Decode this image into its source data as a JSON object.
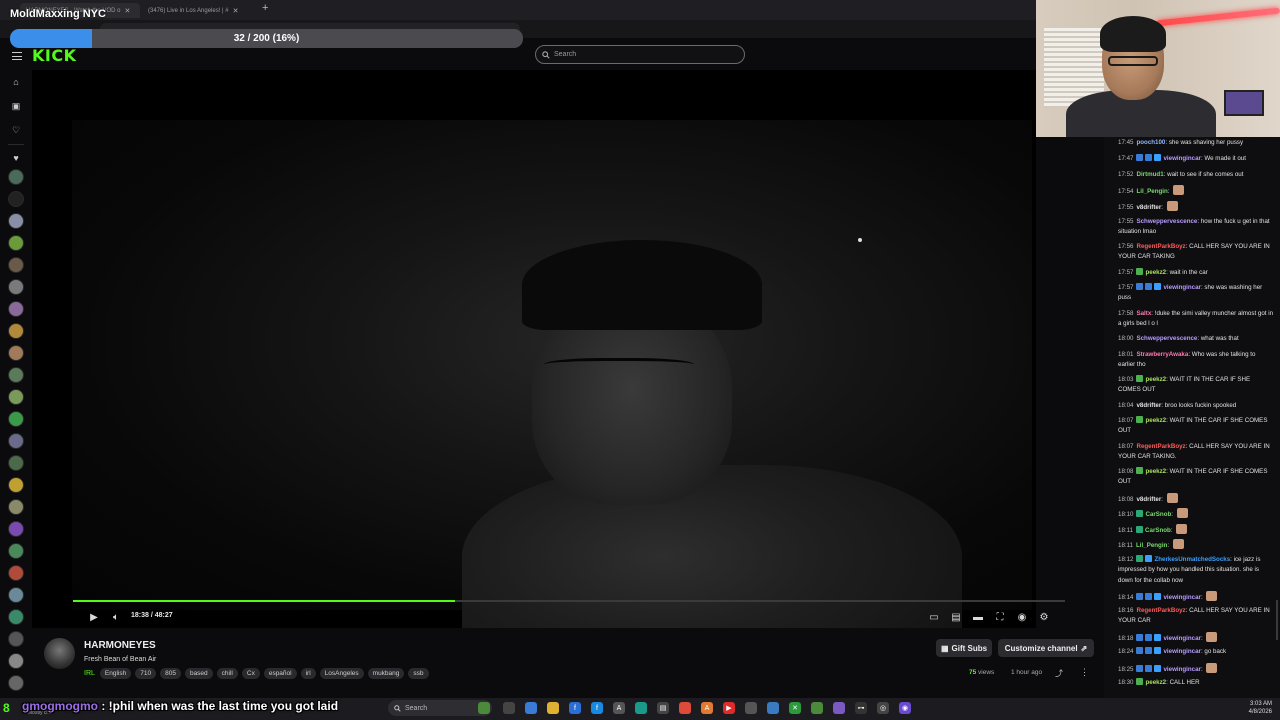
{
  "stream_overlay": {
    "title": "MoldMaxxing NYC",
    "progress_label": "32 / 200 (16%)",
    "progress_fraction": 0.16
  },
  "browser": {
    "tabs": [
      {
        "label": "HARMONEYES - Watch the VOD o"
      },
      {
        "label": "(3476) Live in Los Angeles! | #"
      }
    ]
  },
  "header": {
    "logo": "KICK",
    "search_placeholder": "Search"
  },
  "player": {
    "time": "18:38 / 48:27",
    "seek_fraction": 0.385
  },
  "channel": {
    "name": "HARMONEYES",
    "stream_title": "Fresh Bean of Bean Air",
    "category": "IRL",
    "tags": [
      "English",
      "710",
      "805",
      "based",
      "chill",
      "Cx",
      "español",
      "irl",
      "LosAngeles",
      "mukbang",
      "ssb"
    ],
    "gift_label": "Gift Subs",
    "customize_label": "Customize channel",
    "views_count": "75",
    "views_label": "views",
    "uptime": "1 hour ago"
  },
  "chat": {
    "messages": [
      {
        "ts": "17:45",
        "user": "pooch100",
        "color": "#8fb8ff",
        "text": "she was shaving her pussy",
        "badges": [],
        "emote": false
      },
      {
        "ts": "17:47",
        "user": "viewingincar",
        "color": "#b79cff",
        "text": "We made it out",
        "badges": [
          "#3a7bd5",
          "#3a7bd5",
          "#3aa0ff"
        ],
        "emote": false
      },
      {
        "ts": "17:52",
        "user": "Dirtmud1",
        "color": "#7ad96f",
        "text": "wait to see if she comes out",
        "badges": [],
        "emote": false
      },
      {
        "ts": "17:54",
        "user": "Lil_Pengin",
        "color": "#7ad96f",
        "text": "",
        "badges": [],
        "emote": true
      },
      {
        "ts": "17:55",
        "user": "v8drifter",
        "color": "#e2e2e2",
        "text": "",
        "badges": [],
        "emote": true
      },
      {
        "ts": "17:55",
        "user": "Schweppervescence",
        "color": "#b79cff",
        "text": "how the fuck u get in that situation lmao",
        "badges": [],
        "emote": false
      },
      {
        "ts": "17:56",
        "user": "RegentParkBoyz",
        "color": "#ff5a5a",
        "text": "CALL HER SAY YOU ARE IN YOUR CAR TAKING",
        "badges": [],
        "emote": false
      },
      {
        "ts": "17:57",
        "user": "peekz2",
        "color": "#a8e05f",
        "text": "wait in the car",
        "badges": [
          "#4caf50"
        ],
        "emote": false
      },
      {
        "ts": "17:57",
        "user": "viewingincar",
        "color": "#b79cff",
        "text": "she was washing her puss",
        "badges": [
          "#3a7bd5",
          "#3a7bd5",
          "#3aa0ff"
        ],
        "emote": false
      },
      {
        "ts": "17:58",
        "user": "Saltx",
        "color": "#ff7ab0",
        "text": "!duke the simi valley muncher almost got in a girls bed l o l",
        "badges": [],
        "emote": false
      },
      {
        "ts": "18:00",
        "user": "Schweppervescence",
        "color": "#b79cff",
        "text": "what was that",
        "badges": [],
        "emote": false
      },
      {
        "ts": "18:01",
        "user": "StrawberryAwaka",
        "color": "#ff7ab0",
        "text": "Who was she talking to earlier tho",
        "badges": [],
        "emote": false
      },
      {
        "ts": "18:03",
        "user": "peekz2",
        "color": "#a8e05f",
        "text": "WAIT IT IN THE CAR IF SHE COMES OUT",
        "badges": [
          "#4caf50"
        ],
        "emote": false
      },
      {
        "ts": "18:04",
        "user": "v8drifter",
        "color": "#e2e2e2",
        "text": "broo looks fuckin spooked",
        "badges": [],
        "emote": false
      },
      {
        "ts": "18:07",
        "user": "peekz2",
        "color": "#a8e05f",
        "text": "WAIT IN THE CAR IF SHE COMES OUT",
        "badges": [
          "#4caf50"
        ],
        "emote": false
      },
      {
        "ts": "18:07",
        "user": "RegentParkBoyz",
        "color": "#ff5a5a",
        "text": "CALL HER SAY YOU ARE IN YOUR CAR TAKING.",
        "badges": [],
        "emote": false
      },
      {
        "ts": "18:08",
        "user": "peekz2",
        "color": "#a8e05f",
        "text": "WAIT IN THE CAR IF SHE COMES OUT",
        "badges": [
          "#4caf50"
        ],
        "emote": false
      },
      {
        "ts": "18:08",
        "user": "v8drifter",
        "color": "#e2e2e2",
        "text": "",
        "badges": [],
        "emote": true
      },
      {
        "ts": "18:10",
        "user": "CarSnob",
        "color": "#7ad96f",
        "text": "",
        "badges": [
          "#2aa876"
        ],
        "emote": true
      },
      {
        "ts": "18:11",
        "user": "CarSnob",
        "color": "#7ad96f",
        "text": "",
        "badges": [
          "#2aa876"
        ],
        "emote": true
      },
      {
        "ts": "18:11",
        "user": "Lil_Pengin",
        "color": "#7ad96f",
        "text": "",
        "badges": [],
        "emote": true
      },
      {
        "ts": "18:12",
        "user": "ZherkesUnmatchedSocks",
        "color": "#3aa0ff",
        "text": "ice jazz is impressed by how you handled this situation. she is down for the collab now",
        "badges": [
          "#2aa876",
          "#3aa0ff"
        ],
        "emote": false
      },
      {
        "ts": "18:14",
        "user": "viewingincar",
        "color": "#b79cff",
        "text": "",
        "badges": [
          "#3a7bd5",
          "#3a7bd5",
          "#3aa0ff"
        ],
        "emote": true
      },
      {
        "ts": "18:16",
        "user": "RegentParkBoyz",
        "color": "#ff5a5a",
        "text": "CALL HER SAY YOU ARE IN YOUR CAR",
        "badges": [],
        "emote": false
      },
      {
        "ts": "18:18",
        "user": "viewingincar",
        "color": "#b79cff",
        "text": "",
        "badges": [
          "#3a7bd5",
          "#3a7bd5",
          "#3aa0ff"
        ],
        "emote": true
      },
      {
        "ts": "18:24",
        "user": "viewingincar",
        "color": "#b79cff",
        "text": "go back",
        "badges": [
          "#3a7bd5",
          "#3a7bd5",
          "#3aa0ff"
        ],
        "emote": false
      },
      {
        "ts": "18:25",
        "user": "viewingincar",
        "color": "#b79cff",
        "text": "",
        "badges": [
          "#3a7bd5",
          "#3a7bd5",
          "#3aa0ff"
        ],
        "emote": true
      },
      {
        "ts": "18:30",
        "user": "peekz2",
        "color": "#a8e05f",
        "text": "CALL HER",
        "badges": [
          "#4caf50"
        ],
        "emote": false
      }
    ]
  },
  "overlay_chat": {
    "user": "gmogmogmo",
    "text": " : !phil when was the last time you got laid"
  },
  "taskbar": {
    "search_label": "Search",
    "weather": "Mostly cl...",
    "time": "3:03 AM",
    "date": "4/8/2026"
  },
  "colors": {
    "kick_green": "#53fc18",
    "progress_blue": "#3b8eea",
    "background": "#0b0b0d"
  }
}
